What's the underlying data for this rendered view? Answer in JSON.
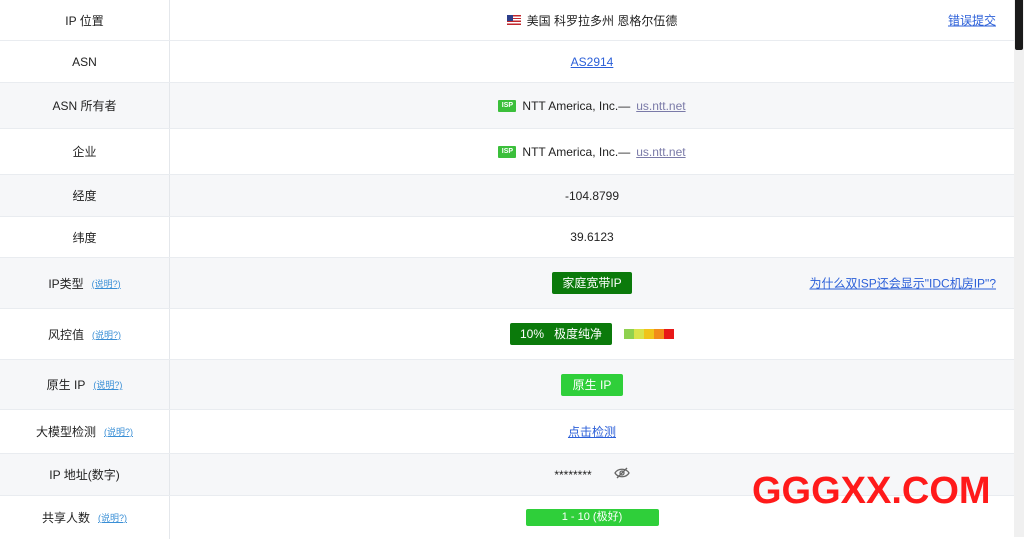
{
  "rows": {
    "ip_location": {
      "label": "IP 位置",
      "value": "美国 科罗拉多州 恩格尔伍德",
      "right_link": "错误提交"
    },
    "asn": {
      "label": "ASN",
      "value": "AS2914"
    },
    "asn_owner": {
      "label": "ASN 所有者",
      "badge": "ISP",
      "company": "NTT America, Inc.—",
      "domain": "us.ntt.net"
    },
    "enterprise": {
      "label": "企业",
      "badge": "ISP",
      "company": "NTT America, Inc.—",
      "domain": "us.ntt.net"
    },
    "longitude": {
      "label": "经度",
      "value": "-104.8799"
    },
    "latitude": {
      "label": "纬度",
      "value": "39.6123"
    },
    "ip_type": {
      "label": "IP类型",
      "help": "(说明?)",
      "value": "家庭宽带IP",
      "right_link": "为什么双ISP还会显示\"IDC机房IP\"?"
    },
    "risk": {
      "label": "风控值",
      "help": "(说明?)",
      "value": "10%   极度纯净"
    },
    "native_ip": {
      "label": "原生 IP",
      "help": "(说明?)",
      "value": "原生 IP"
    },
    "llm_detect": {
      "label": "大模型检测",
      "help": "(说明?)",
      "value": "点击检测"
    },
    "ip_numeric": {
      "label": "IP 地址(数字)",
      "value": "********"
    },
    "shared_users": {
      "label": "共享人数",
      "help": "(说明?)",
      "value": "1 - 10 (极好)"
    }
  },
  "risk_scale_colors": [
    "#8fd14f",
    "#d8e34a",
    "#f0c419",
    "#f28c18",
    "#e81818"
  ],
  "watermark": "GGGXX.COM",
  "colors": {
    "accent_dark_green": "#0b7a0b",
    "accent_green": "#2fcf3a",
    "link": "#2b5fd8",
    "watermark": "#ff1a1a"
  }
}
